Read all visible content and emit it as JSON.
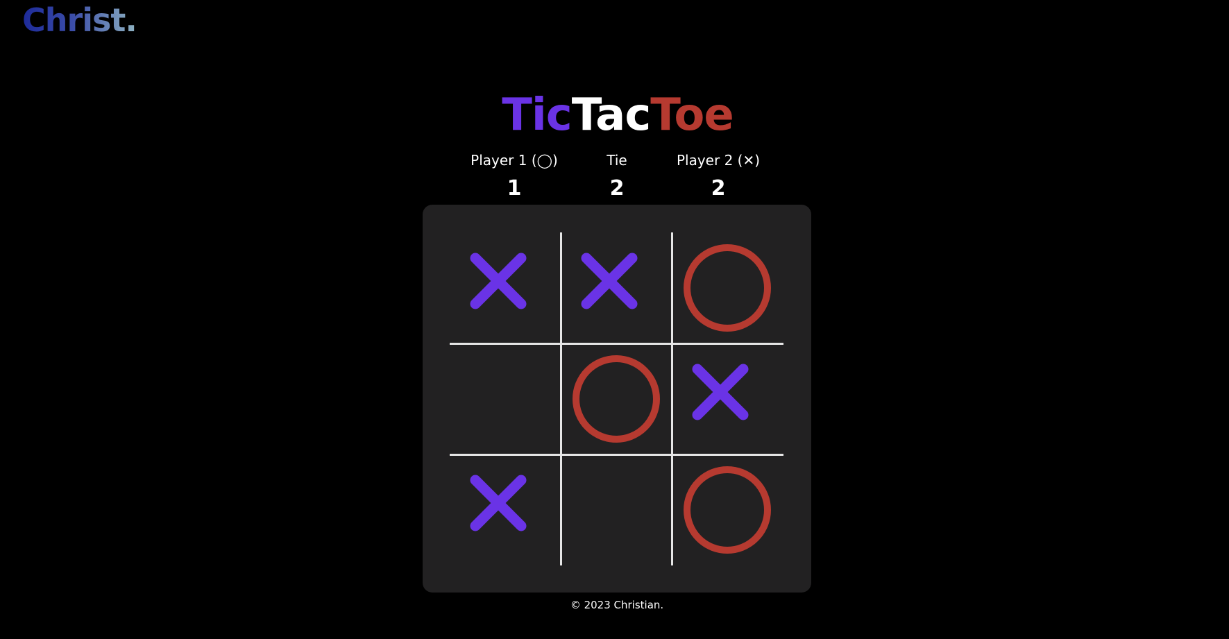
{
  "logo": {
    "text": "Christ."
  },
  "title": {
    "parts": [
      {
        "text": "Tic",
        "color": "#6a33e6"
      },
      {
        "text": "Tac",
        "color": "#ffffff"
      },
      {
        "text": "Toe",
        "color": "#b63a30"
      }
    ]
  },
  "scoreboard": [
    {
      "label": "Player 1 (◯)",
      "value": "1"
    },
    {
      "label": "Tie",
      "value": "2"
    },
    {
      "label": "Player 2 (✕)",
      "value": "2"
    }
  ],
  "board": {
    "cells": [
      "X",
      "X",
      "O",
      "",
      "O",
      "X",
      "X",
      "",
      "O"
    ],
    "colors": {
      "X": "#6a33e6",
      "O": "#b63a30",
      "grid": "#e6e6e6",
      "panel": "#222122"
    }
  },
  "footer": {
    "text": "© 2023 Christian."
  }
}
